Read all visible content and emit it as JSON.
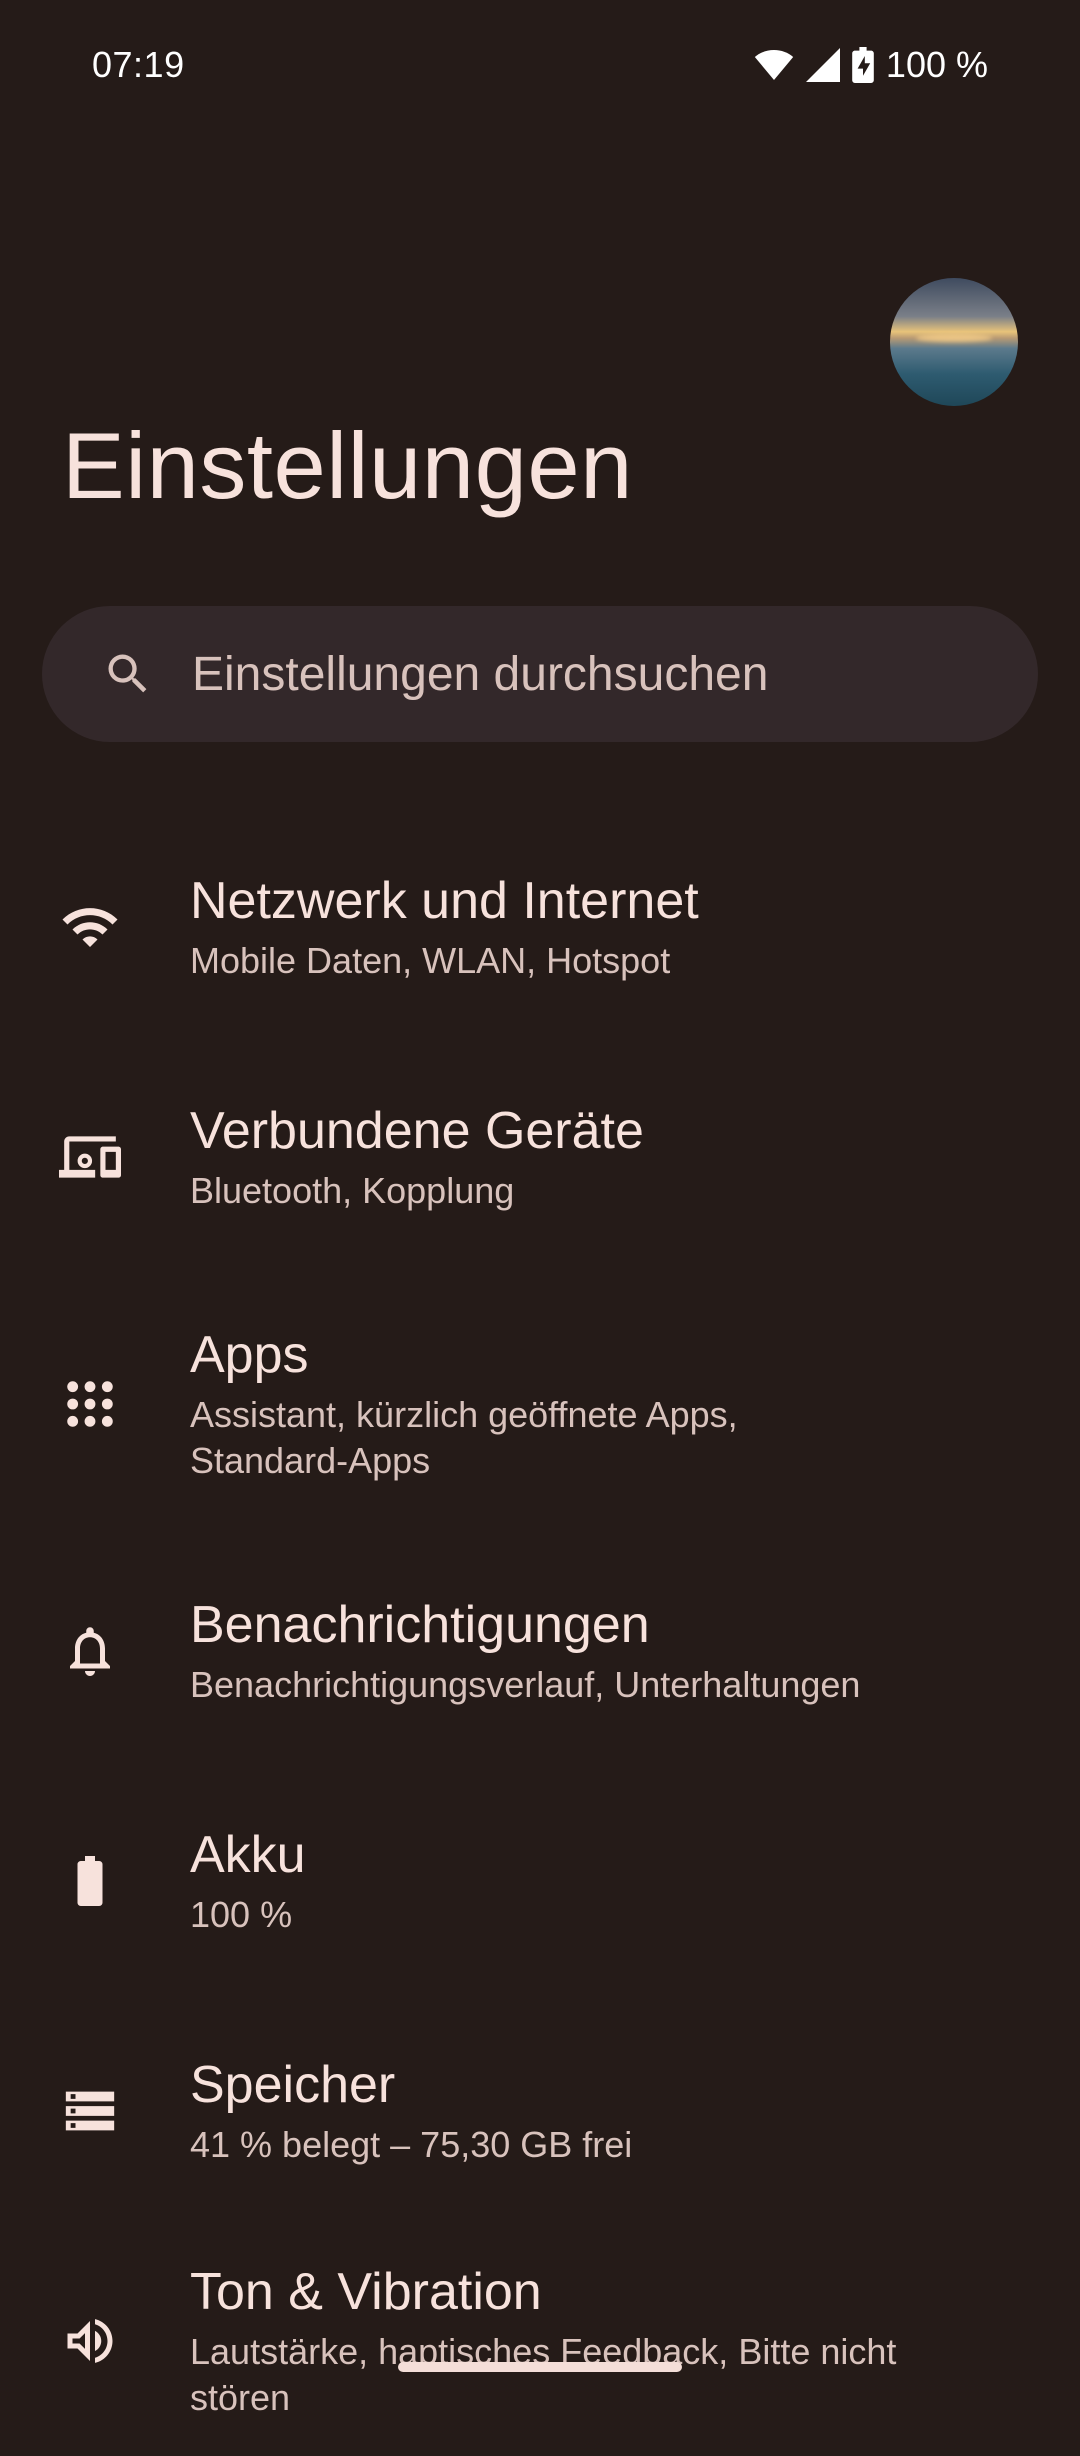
{
  "status_bar": {
    "time": "07:19",
    "battery_percent": "100 %",
    "wifi_icon": "wifi-icon",
    "signal_icon": "cell-signal-icon",
    "battery_icon": "battery-charging-icon"
  },
  "header": {
    "title": "Einstellungen",
    "avatar_icon": "profile-avatar"
  },
  "search": {
    "placeholder": "Einstellungen durchsuchen",
    "icon": "search-icon"
  },
  "settings": [
    {
      "title": "Netzwerk und Internet",
      "subtitle": "Mobile Daten, WLAN, Hotspot",
      "icon": "wifi-icon"
    },
    {
      "title": "Verbundene Geräte",
      "subtitle": "Bluetooth, Kopplung",
      "icon": "devices-icon"
    },
    {
      "title": "Apps",
      "subtitle": "Assistant, kürzlich geöffnete Apps, Standard-Apps",
      "icon": "apps-grid-icon"
    },
    {
      "title": "Benachrichtigungen",
      "subtitle": "Benachrichtigungsverlauf, Unterhaltungen",
      "icon": "bell-icon"
    },
    {
      "title": "Akku",
      "subtitle": "100 %",
      "icon": "battery-icon"
    },
    {
      "title": "Speicher",
      "subtitle": "41 % belegt – 75,30 GB frei",
      "icon": "storage-icon"
    },
    {
      "title": "Ton & Vibration",
      "subtitle": "Lautstärke, haptisches Feedback, Bitte nicht stören",
      "icon": "volume-icon"
    }
  ],
  "colors": {
    "background": "#251b18",
    "search_background": "#33282a",
    "text_primary": "#f7e2dc",
    "text_secondary": "#d8c2bc"
  }
}
